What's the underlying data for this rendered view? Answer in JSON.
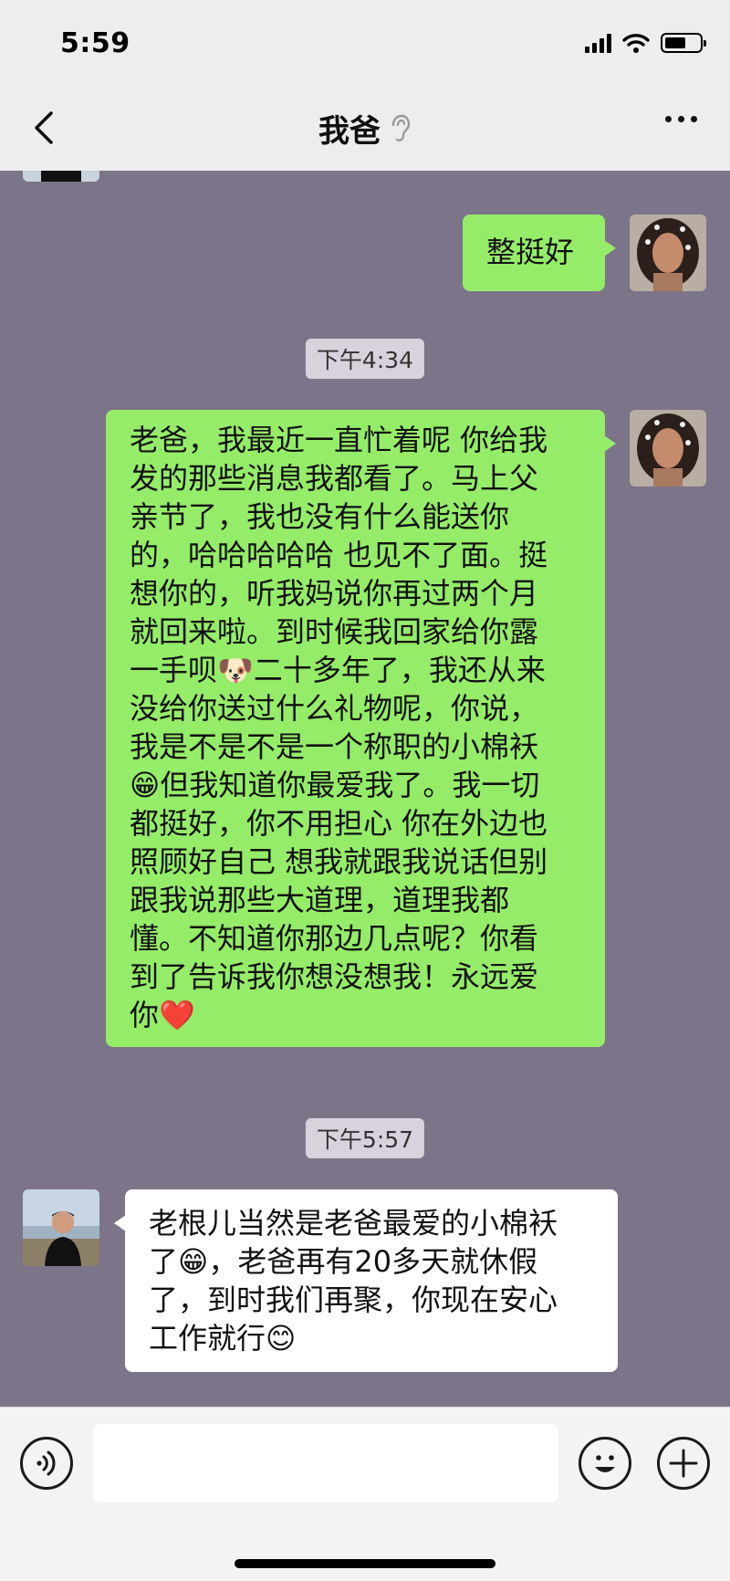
{
  "status": {
    "time": "5:59"
  },
  "header": {
    "title": "我爸"
  },
  "messages": [
    {
      "type": "text",
      "side": "right",
      "text": "整挺好"
    },
    {
      "type": "time",
      "text": "下午4:34"
    },
    {
      "type": "text",
      "side": "right",
      "lines": [
        "老爸，我最近一直忙着呢 你给我",
        "发的那些消息我都看了。马上父",
        "亲节了，我也没有什么能送你",
        "的，哈哈哈哈哈 也见不了面。挺",
        "想你的，听我妈说你再过两个月",
        "就回来啦。到时候我回家给你露",
        "一手呗🐶二十多年了，我还从来",
        "没给你送过什么礼物呢，你说，",
        "我是不是不是一个称职的小棉袄",
        "😁但我知道你最爱我了。我一切",
        "都挺好，你不用担心 你在外边也",
        "照顾好自己 想我就跟我说话但别",
        "跟我说那些大道理，道理我都",
        "懂。不知道你那边几点呢？你看",
        "到了告诉我你想没想我！永远爱",
        "你❤️"
      ]
    },
    {
      "type": "time",
      "text": "下午5:57"
    },
    {
      "type": "text",
      "side": "left",
      "lines": [
        "老根儿当然是老爸最爱的小棉袄",
        "了😁，老爸再有20多天就休假",
        "了，到时我们再聚，你现在安心",
        "工作就行😊"
      ]
    }
  ],
  "colors": {
    "chat_bg": "#7c7488",
    "bubble_green": "#95ec69",
    "bubble_white": "#ffffff"
  }
}
